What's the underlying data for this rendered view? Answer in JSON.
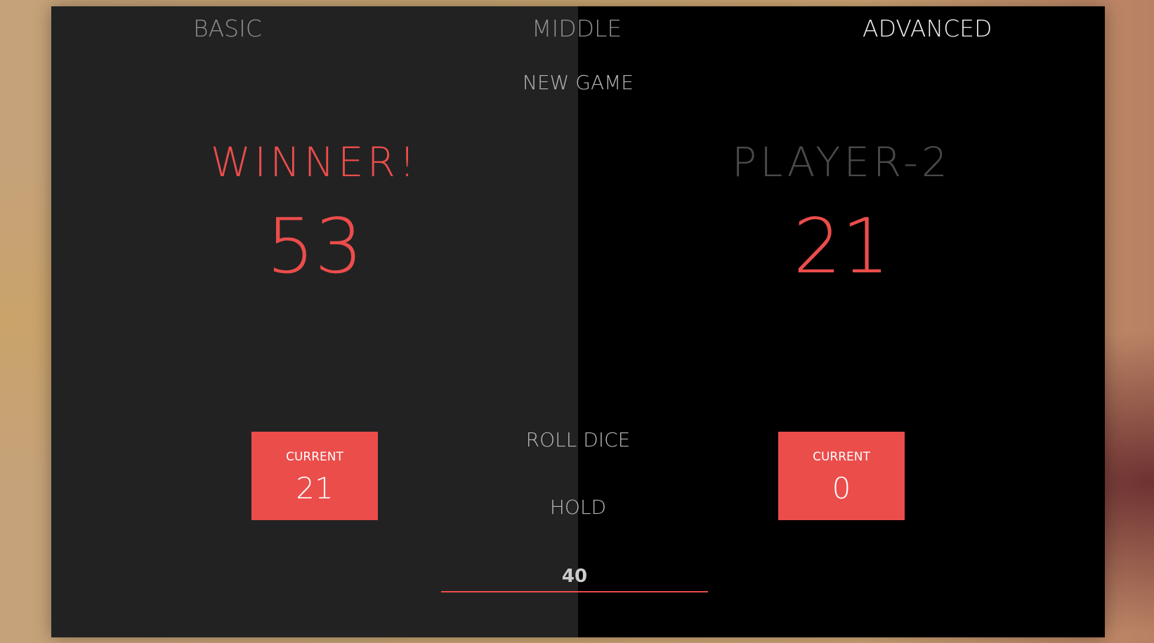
{
  "levels": [
    {
      "label": "BASIC",
      "active": false
    },
    {
      "label": "MIDDLE",
      "active": false
    },
    {
      "label": "ADVANCED",
      "active": true
    }
  ],
  "controls": {
    "new_game": "NEW GAME",
    "roll_dice": "ROLL DICE",
    "hold": "HOLD",
    "final_score": "40"
  },
  "players": [
    {
      "name": "WINNER!",
      "score": "53",
      "current_label": "CURRENT",
      "current": "21",
      "state": "winner"
    },
    {
      "name": "PLAYER-2",
      "score": "21",
      "current_label": "CURRENT",
      "current": "0",
      "state": "inactive"
    }
  ],
  "colors": {
    "accent": "#eb4d4b",
    "panel_1": "#222222",
    "panel_2": "#000000"
  }
}
